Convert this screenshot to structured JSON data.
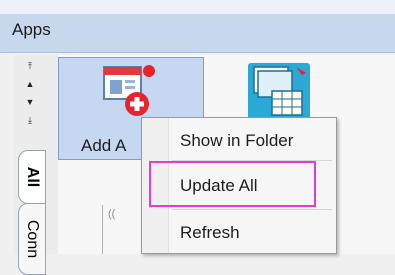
{
  "header": {
    "title": "Apps"
  },
  "rail": {
    "scroll_buttons": [
      {
        "icon": "scroll-first-icon",
        "glyph": "⤒"
      },
      {
        "icon": "scroll-up-icon",
        "glyph": "▲"
      },
      {
        "icon": "scroll-down-icon",
        "glyph": "▼"
      },
      {
        "icon": "scroll-last-icon",
        "glyph": "⤓"
      }
    ],
    "tabs": [
      "All",
      "Conn"
    ]
  },
  "tiles": [
    {
      "label": "Add A",
      "icon": "add-app-icon"
    },
    {
      "label": "",
      "icon": "app-grid-icon"
    }
  ],
  "context_menu": {
    "items": [
      "Show in Folder",
      "Update All",
      "Refresh"
    ],
    "highlighted": "Update All"
  },
  "colors": {
    "header_bg": "#c7d7ec",
    "tile_selected_bg": "#c6d8f1",
    "highlight_border": "#e23bd9",
    "badge_red": "#e8232d"
  }
}
